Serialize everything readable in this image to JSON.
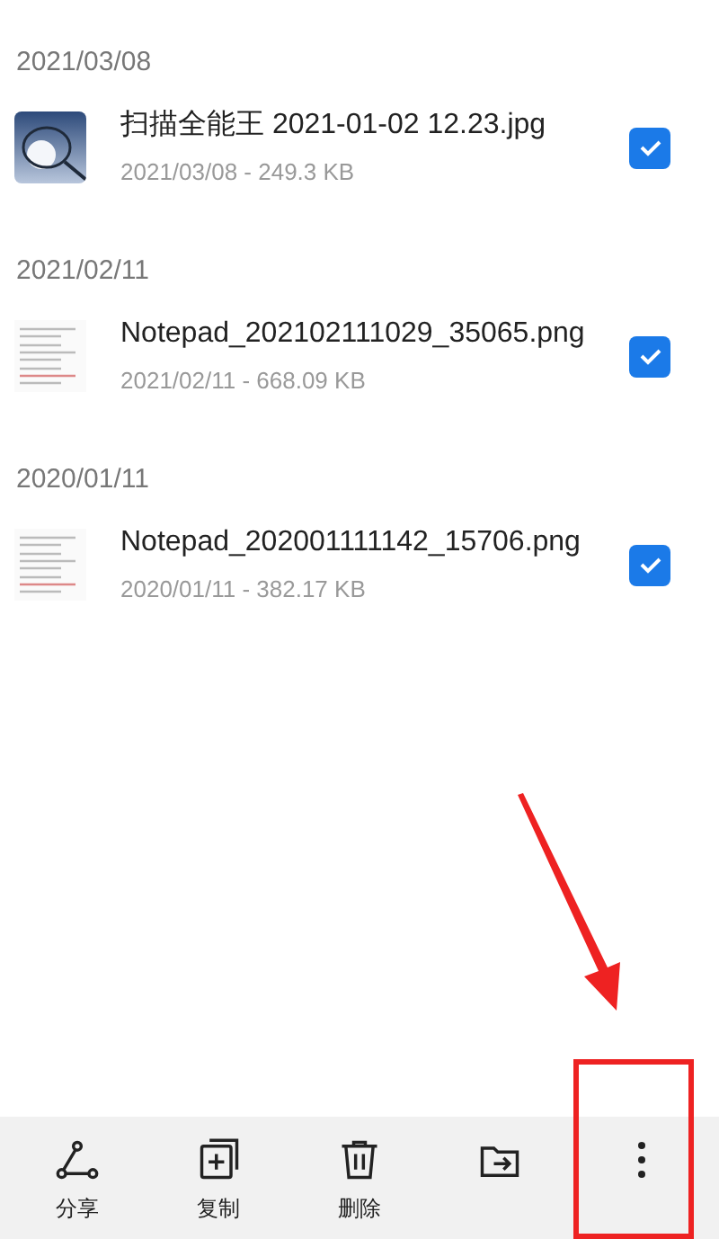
{
  "groups": [
    {
      "date": "2021/03/08",
      "files": [
        {
          "name": "扫描全能王 2021-01-02 12.23.jpg",
          "meta": "2021/03/08 - 249.3 KB",
          "checked": true
        }
      ]
    },
    {
      "date": "2021/02/11",
      "files": [
        {
          "kind": "document",
          "name": "Notepad_202102111029_35065.png",
          "meta": "2021/02/11 - 668.09 KB",
          "checked": true
        }
      ]
    },
    {
      "date": "2020/01/11",
      "files": [
        {
          "kind": "document",
          "name": "Notepad_202001111142_15706.png",
          "meta": "2020/01/11 - 382.17 KB",
          "checked": true
        }
      ]
    }
  ],
  "toolbar": [
    {
      "kind": "share",
      "label": "分享"
    },
    {
      "kind": "copy",
      "label": "复制"
    },
    {
      "kind": "delete",
      "label": "删除"
    },
    {
      "kind": "move"
    },
    {
      "kind": "more"
    }
  ]
}
